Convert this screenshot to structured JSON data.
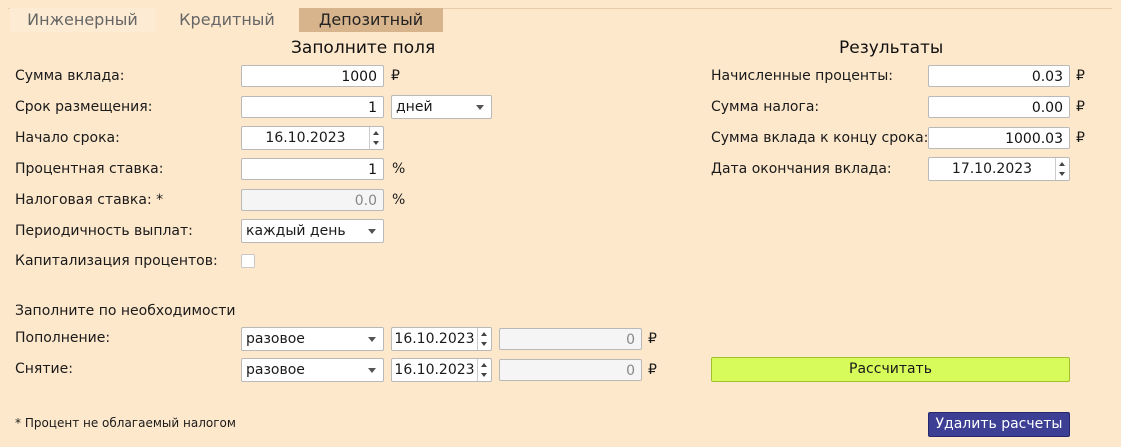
{
  "tabs": [
    {
      "label": "Инженерный"
    },
    {
      "label": "Кредитный"
    },
    {
      "label": "Депозитный"
    }
  ],
  "active_tab": "Депозитный",
  "form": {
    "heading": "Заполните поля",
    "deposit_amount": {
      "label": "Сумма вклада:",
      "value": "1000",
      "unit": "₽"
    },
    "term": {
      "label": "Срок размещения:",
      "value": "1",
      "unit_selected": "дней"
    },
    "start_date": {
      "label": "Начало срока:",
      "value": "16.10.2023"
    },
    "interest_rate": {
      "label": "Процентная ставка:",
      "value": "1",
      "unit": "%"
    },
    "tax_rate": {
      "label": "Налоговая ставка: *",
      "value": "0.0",
      "unit": "%"
    },
    "payout_frequency": {
      "label": "Периодичность выплат:",
      "selected": "каждый день"
    },
    "capitalization": {
      "label": "Капитализация процентов:",
      "checked": false
    }
  },
  "optional": {
    "heading": "Заполните по необходимости",
    "deposit_topup": {
      "label": "Пополнение:",
      "type_selected": "разовое",
      "date": "16.10.2023",
      "amount": "0",
      "unit": "₽"
    },
    "withdrawal": {
      "label": "Снятие:",
      "type_selected": "разовое",
      "date": "16.10.2023",
      "amount": "0",
      "unit": "₽"
    }
  },
  "results": {
    "heading": "Результаты",
    "accrued_interest": {
      "label": "Начисленные проценты:",
      "value": "0.03",
      "unit": "₽"
    },
    "tax_amount": {
      "label": "Сумма налога:",
      "value": "0.00",
      "unit": "₽"
    },
    "final_amount": {
      "label": "Сумма вклада к концу срока:",
      "value": "1000.03",
      "unit": "₽"
    },
    "end_date": {
      "label": "Дата окончания вклада:",
      "value": "17.10.2023"
    }
  },
  "buttons": {
    "calculate": "Рассчитать",
    "delete": "Удалить расчеты"
  },
  "footnote": "* Процент не облагаемый налогом",
  "colors": {
    "background": "#fde8cc",
    "active_tab": "#d8b48c",
    "calculate_button": "#d7fb5a",
    "delete_button": "#3d3f95"
  }
}
